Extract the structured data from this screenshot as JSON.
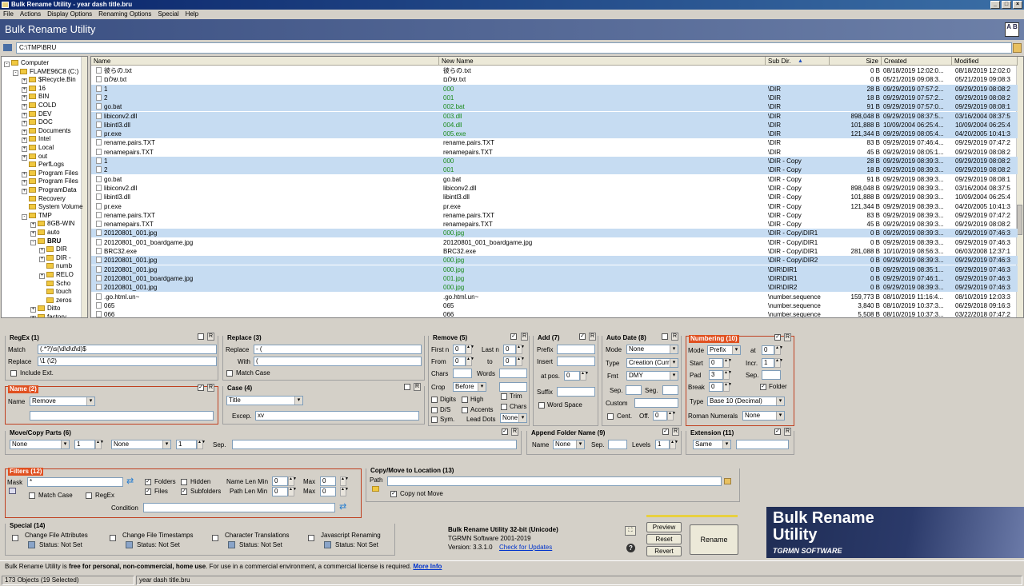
{
  "window": {
    "title": "Bulk Rename Utility - year dash title.bru"
  },
  "menu": [
    "File",
    "Actions",
    "Display Options",
    "Renaming Options",
    "Special",
    "Help"
  ],
  "header": {
    "title": "Bulk Rename Utility",
    "badge": "A B"
  },
  "path": {
    "value": "C:\\TMP\\BRU"
  },
  "tree": [
    {
      "label": "Computer",
      "depth": 0,
      "exp": "-"
    },
    {
      "label": "FLAME96C8 (C:)",
      "depth": 1,
      "exp": "-"
    },
    {
      "label": "$Recycle.Bin",
      "depth": 2,
      "exp": "+"
    },
    {
      "label": "16",
      "depth": 2,
      "exp": "+"
    },
    {
      "label": "BIN",
      "depth": 2,
      "exp": "+"
    },
    {
      "label": "COLD",
      "depth": 2,
      "exp": "+"
    },
    {
      "label": "DEV",
      "depth": 2,
      "exp": "+"
    },
    {
      "label": "DOC",
      "depth": 2,
      "exp": "+"
    },
    {
      "label": "Documents",
      "depth": 2,
      "exp": "+"
    },
    {
      "label": "Intel",
      "depth": 2,
      "exp": "+"
    },
    {
      "label": "Local",
      "depth": 2,
      "exp": "+"
    },
    {
      "label": "out",
      "depth": 2,
      "exp": "+"
    },
    {
      "label": "PerfLogs",
      "depth": 2,
      "exp": ""
    },
    {
      "label": "Program Files",
      "depth": 2,
      "exp": "+"
    },
    {
      "label": "Program Files",
      "depth": 2,
      "exp": "+"
    },
    {
      "label": "ProgramData",
      "depth": 2,
      "exp": "+"
    },
    {
      "label": "Recovery",
      "depth": 2,
      "exp": ""
    },
    {
      "label": "System Volume",
      "depth": 2,
      "exp": ""
    },
    {
      "label": "TMP",
      "depth": 2,
      "exp": "-"
    },
    {
      "label": "8GB-WIN",
      "depth": 3,
      "exp": "+"
    },
    {
      "label": "auto",
      "depth": 3,
      "exp": "+"
    },
    {
      "label": "BRU",
      "depth": 3,
      "exp": "-",
      "sel": true
    },
    {
      "label": "DIR",
      "depth": 4,
      "exp": "+"
    },
    {
      "label": "DIR -",
      "depth": 4,
      "exp": "+"
    },
    {
      "label": "numb",
      "depth": 4,
      "exp": ""
    },
    {
      "label": "RELO",
      "depth": 4,
      "exp": "+"
    },
    {
      "label": "Scho",
      "depth": 4,
      "exp": ""
    },
    {
      "label": "touch",
      "depth": 4,
      "exp": ""
    },
    {
      "label": "zeros",
      "depth": 4,
      "exp": ""
    },
    {
      "label": "Ditto",
      "depth": 3,
      "exp": "+"
    },
    {
      "label": "factory",
      "depth": 3,
      "exp": "+"
    }
  ],
  "filelist": {
    "headers": [
      "Name",
      "New Name",
      "Sub Dir.",
      "Size",
      "Created",
      "Modified"
    ],
    "rows": [
      {
        "name": "彼らの.txt",
        "newname": "彼らの.txt",
        "subdir": "",
        "size": "0 B",
        "created": "08/18/2019 12:02:0...",
        "modified": "08/18/2019 12:02:0",
        "sel": false,
        "green": false
      },
      {
        "name": "שלום.txt",
        "newname": "שלום.txt",
        "subdir": "",
        "size": "0 B",
        "created": "05/21/2019 09:08:3...",
        "modified": "05/21/2019 09:08:3",
        "sel": false,
        "green": false
      },
      {
        "name": "1",
        "newname": "000",
        "subdir": "\\DIR",
        "size": "28 B",
        "created": "09/29/2019 07:57:2...",
        "modified": "09/29/2019 08:08:2",
        "sel": true,
        "green": true
      },
      {
        "name": "2",
        "newname": "001",
        "subdir": "\\DIR",
        "size": "18 B",
        "created": "09/29/2019 07:57:2...",
        "modified": "09/29/2019 08:08:2",
        "sel": true,
        "green": true
      },
      {
        "name": "go.bat",
        "newname": "002.bat",
        "subdir": "\\DIR",
        "size": "91 B",
        "created": "09/29/2019 07:57:0...",
        "modified": "09/29/2019 08:08:1",
        "sel": true,
        "green": true
      },
      {
        "name": "libiconv2.dll",
        "newname": "003.dll",
        "subdir": "\\DIR",
        "size": "898,048 B",
        "created": "09/29/2019 08:37:5...",
        "modified": "03/16/2004 08:37:5",
        "sel": true,
        "green": true
      },
      {
        "name": "libintl3.dll",
        "newname": "004.dll",
        "subdir": "\\DIR",
        "size": "101,888 B",
        "created": "10/09/2004 06:25:4...",
        "modified": "10/09/2004 06:25:4",
        "sel": true,
        "green": true
      },
      {
        "name": "pr.exe",
        "newname": "005.exe",
        "subdir": "\\DIR",
        "size": "121,344 B",
        "created": "09/29/2019 08:05:4...",
        "modified": "04/20/2005 10:41:3",
        "sel": true,
        "green": true
      },
      {
        "name": "rename.pairs.TXT",
        "newname": "rename.pairs.TXT",
        "subdir": "\\DIR",
        "size": "83 B",
        "created": "09/29/2019 07:46:4...",
        "modified": "09/29/2019 07:47:2",
        "sel": false,
        "green": false
      },
      {
        "name": "renamepairs.TXT",
        "newname": "renamepairs.TXT",
        "subdir": "\\DIR",
        "size": "45 B",
        "created": "09/29/2019 08:05:1...",
        "modified": "09/29/2019 08:08:2",
        "sel": false,
        "green": false
      },
      {
        "name": "1",
        "newname": "000",
        "subdir": "\\DIR - Copy",
        "size": "28 B",
        "created": "09/29/2019 08:39:3...",
        "modified": "09/29/2019 08:08:2",
        "sel": true,
        "green": true
      },
      {
        "name": "2",
        "newname": "001",
        "subdir": "\\DIR - Copy",
        "size": "18 B",
        "created": "09/29/2019 08:39:3...",
        "modified": "09/29/2019 08:08:2",
        "sel": true,
        "green": true
      },
      {
        "name": "go.bat",
        "newname": "go.bat",
        "subdir": "\\DIR - Copy",
        "size": "91 B",
        "created": "09/29/2019 08:39:3...",
        "modified": "09/29/2019 08:08:1",
        "sel": false,
        "green": false
      },
      {
        "name": "libiconv2.dll",
        "newname": "libiconv2.dll",
        "subdir": "\\DIR - Copy",
        "size": "898,048 B",
        "created": "09/29/2019 08:39:3...",
        "modified": "03/16/2004 08:37:5",
        "sel": false,
        "green": false
      },
      {
        "name": "libintl3.dll",
        "newname": "libintl3.dll",
        "subdir": "\\DIR - Copy",
        "size": "101,888 B",
        "created": "09/29/2019 08:39:3...",
        "modified": "10/09/2004 06:25:4",
        "sel": false,
        "green": false
      },
      {
        "name": "pr.exe",
        "newname": "pr.exe",
        "subdir": "\\DIR - Copy",
        "size": "121,344 B",
        "created": "09/29/2019 08:39:3...",
        "modified": "04/20/2005 10:41:3",
        "sel": false,
        "green": false
      },
      {
        "name": "rename.pairs.TXT",
        "newname": "rename.pairs.TXT",
        "subdir": "\\DIR - Copy",
        "size": "83 B",
        "created": "09/29/2019 08:39:3...",
        "modified": "09/29/2019 07:47:2",
        "sel": false,
        "green": false
      },
      {
        "name": "renamepairs.TXT",
        "newname": "renamepairs.TXT",
        "subdir": "\\DIR - Copy",
        "size": "45 B",
        "created": "09/29/2019 08:39:3...",
        "modified": "09/29/2019 08:08:2",
        "sel": false,
        "green": false
      },
      {
        "name": "20120801_001.jpg",
        "newname": "000.jpg",
        "subdir": "\\DIR - Copy\\DIR1",
        "size": "0 B",
        "created": "09/29/2019 08:39:3...",
        "modified": "09/29/2019 07:46:3",
        "sel": true,
        "green": true
      },
      {
        "name": "20120801_001_boardgame.jpg",
        "newname": "20120801_001_boardgame.jpg",
        "subdir": "\\DIR - Copy\\DIR1",
        "size": "0 B",
        "created": "09/29/2019 08:39:3...",
        "modified": "09/29/2019 07:46:3",
        "sel": false,
        "green": false
      },
      {
        "name": "BRC32.exe",
        "newname": "BRC32.exe",
        "subdir": "\\DIR - Copy\\DIR1",
        "size": "281,088 B",
        "created": "10/10/2019 08:56:3...",
        "modified": "06/03/2008 12:37:1",
        "sel": false,
        "green": false
      },
      {
        "name": "20120801_001.jpg",
        "newname": "000.jpg",
        "subdir": "\\DIR - Copy\\DIR2",
        "size": "0 B",
        "created": "09/29/2019 08:39:3...",
        "modified": "09/29/2019 07:46:3",
        "sel": true,
        "green": true
      },
      {
        "name": "20120801_001.jpg",
        "newname": "000.jpg",
        "subdir": "\\DIR\\DIR1",
        "size": "0 B",
        "created": "09/29/2019 08:35:1...",
        "modified": "09/29/2019 07:46:3",
        "sel": true,
        "green": true
      },
      {
        "name": "20120801_001_boardgame.jpg",
        "newname": "001.jpg",
        "subdir": "\\DIR\\DIR1",
        "size": "0 B",
        "created": "09/29/2019 07:46:1...",
        "modified": "09/29/2019 07:46:3",
        "sel": true,
        "green": true
      },
      {
        "name": "20120801_001.jpg",
        "newname": "000.jpg",
        "subdir": "\\DIR\\DIR2",
        "size": "0 B",
        "created": "09/29/2019 08:39:3...",
        "modified": "09/29/2019 07:46:3",
        "sel": true,
        "green": true
      },
      {
        "name": ".go.html.un~",
        "newname": ".go.html.un~",
        "subdir": "\\number.sequence",
        "size": "159,773 B",
        "created": "08/10/2019 11:16:4...",
        "modified": "08/10/2019 12:03:3",
        "sel": false,
        "green": false
      },
      {
        "name": "065",
        "newname": "065",
        "subdir": "\\number.sequence",
        "size": "3,840 B",
        "created": "08/10/2019 10:37:3...",
        "modified": "06/29/2018 09:16:3",
        "sel": false,
        "green": false
      },
      {
        "name": "066",
        "newname": "066",
        "subdir": "\\number.sequence",
        "size": "5,508 B",
        "created": "08/10/2019 10:37:3...",
        "modified": "03/22/2018 07:47:2",
        "sel": false,
        "green": false
      }
    ]
  },
  "regex": {
    "title": "RegEx (1)",
    "match_label": "Match",
    "match": "(.*?)\\s(\\d\\d\\d\\d)$",
    "replace_label": "Replace",
    "replace": "\\1 (\\2)",
    "include_ext": "Include Ext."
  },
  "replace": {
    "title": "Replace (3)",
    "replace_label": "Replace",
    "replace": "- (",
    "with_label": "With",
    "with": "(",
    "match_case": "Match Case"
  },
  "remove": {
    "title": "Remove (5)",
    "firstn": "First n",
    "firstn_val": "0",
    "lastn": "Last n",
    "lastn_val": "0",
    "from": "From",
    "from_val": "0",
    "to": "to",
    "to_val": "0",
    "chars": "Chars",
    "words": "Words",
    "crop": "Crop",
    "crop_val": "Before",
    "digits": "Digits",
    "high": "High",
    "ds": "D/S",
    "accents": "Accents",
    "sym": "Sym.",
    "leaddots": "Lead Dots",
    "leaddots_val": "None",
    "trim": "Trim",
    "chars2": "Chars"
  },
  "add": {
    "title": "Add (7)",
    "prefix": "Prefix",
    "insert": "Insert",
    "atpos": "at pos.",
    "atpos_val": "0",
    "suffix": "Suffix",
    "wordspace": "Word Space"
  },
  "autodate": {
    "title": "Auto Date (8)",
    "mode": "Mode",
    "mode_val": "None",
    "type": "Type",
    "type_val": "Creation (Curr.)",
    "fmt": "Fmt",
    "fmt_val": "DMY",
    "sep": "Sep.",
    "seg": "Seg.",
    "custom": "Custom",
    "cent": "Cent.",
    "off": "Off.",
    "off_val": "0"
  },
  "numbering": {
    "title": "Numbering (10)",
    "mode": "Mode",
    "mode_val": "Prefix",
    "at": "at",
    "at_val": "0",
    "start": "Start",
    "start_val": "0",
    "incr": "Incr.",
    "incr_val": "1",
    "pad": "Pad",
    "pad_val": "3",
    "sep": "Sep.",
    "break": "Break",
    "break_val": "0",
    "folder": "Folder",
    "type": "Type",
    "type_val": "Base 10 (Decimal)",
    "roman": "Roman Numerals",
    "roman_val": "None"
  },
  "name": {
    "title": "Name (2)",
    "label": "Name",
    "val": "Remove"
  },
  "case": {
    "title": "Case (4)",
    "val": "Title",
    "excep": "Excep.",
    "excep_val": "xv"
  },
  "moveparts": {
    "title": "Move/Copy Parts (6)",
    "a": "None",
    "b": "1",
    "c": "None",
    "d": "1",
    "sep": "Sep."
  },
  "appendfolder": {
    "title": "Append Folder Name (9)",
    "name": "Name",
    "name_val": "None",
    "sep": "Sep.",
    "levels": "Levels",
    "levels_val": "1"
  },
  "extension": {
    "title": "Extension (11)",
    "val": "Same"
  },
  "filters": {
    "title": "Filters (12)",
    "mask": "Mask",
    "mask_val": "*",
    "folders": "Folders",
    "hidden": "Hidden",
    "files": "Files",
    "subfolders": "Subfolders",
    "namelen": "Name Len Min",
    "namelen_min": "0",
    "max": "Max",
    "namelen_max": "0",
    "pathlen": "Path Len Min",
    "pathlen_min": "0",
    "pathlen_max": "0",
    "matchcase": "Match Case",
    "regex": "RegEx",
    "condition": "Condition"
  },
  "copymove": {
    "title": "Copy/Move to Location (13)",
    "path": "Path",
    "copynot": "Copy not Move"
  },
  "special": {
    "title": "Special (14)",
    "items": [
      {
        "label": "Change File Attributes",
        "status": "Status: Not Set"
      },
      {
        "label": "Change File Timestamps",
        "status": "Status: Not Set"
      },
      {
        "label": "Character Translations",
        "status": "Status: Not Set"
      },
      {
        "label": "Javascript Renaming",
        "status": "Status: Not Set"
      }
    ]
  },
  "about": {
    "name": "Bulk Rename Utility 32-bit (Unicode)",
    "copy": "TGRMN Software 2001-2019",
    "version": "Version: 3.3.1.0",
    "check": "Check for Updates"
  },
  "buttons": {
    "preview": "Preview",
    "reset": "Reset",
    "revert": "Revert",
    "rename": "Rename"
  },
  "brand": {
    "line1": "Bulk Rename",
    "line2": "Utility",
    "line3": "TGRMN SOFTWARE"
  },
  "info": {
    "pre": "Bulk Rename Utility is ",
    "bold": "free for personal, non-commercial, home use",
    "post": ". For use in a commercial environment, a commercial license is required.",
    "more": "More Info"
  },
  "status": {
    "objects": "173 Objects (19 Selected)",
    "file": "year dash title.bru"
  },
  "colors": {
    "accent": "#e05020",
    "selection": "#c6dcf2",
    "newname": "#1a8a1a",
    "header": "#3a4f82"
  }
}
